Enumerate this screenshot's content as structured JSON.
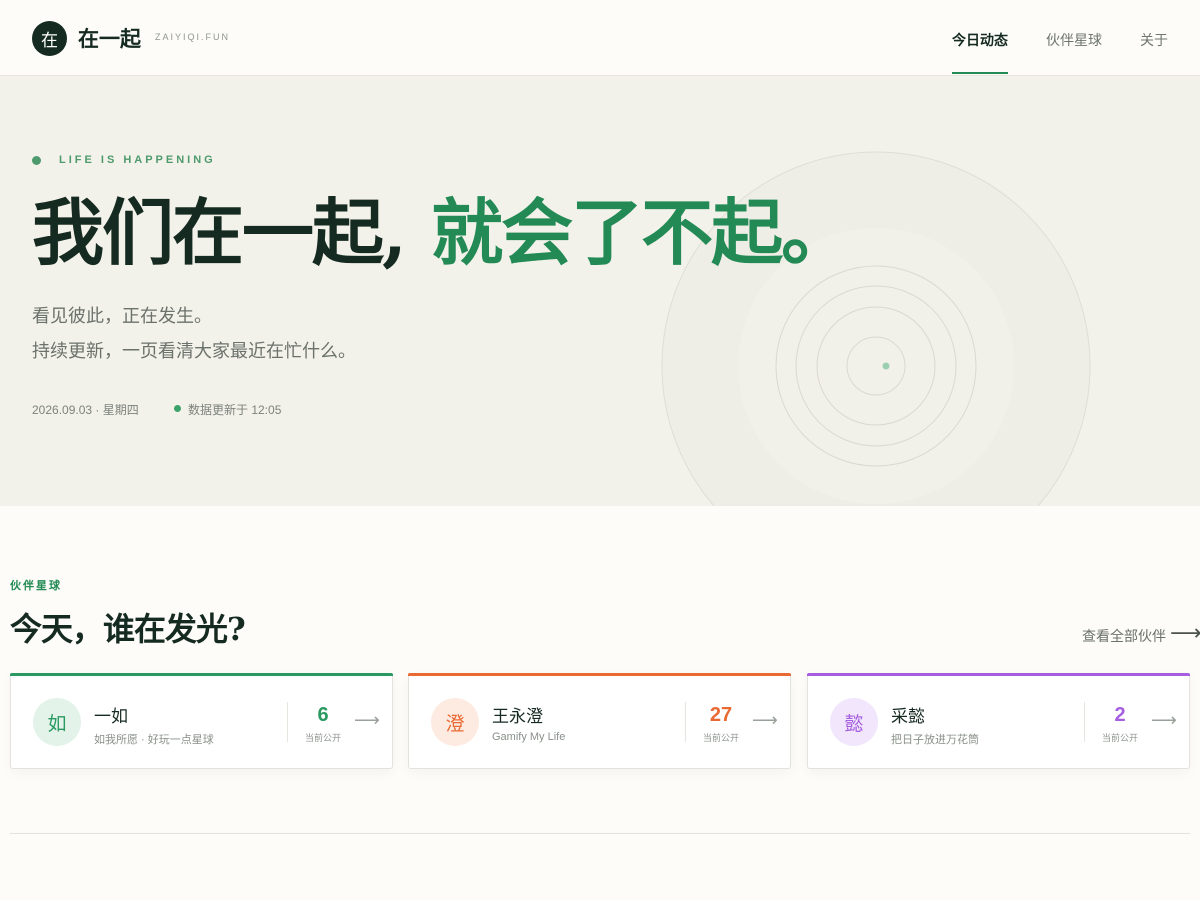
{
  "header": {
    "logo_badge": "在",
    "site_name": "在一起",
    "site_domain": "ZAIYIQI.FUN",
    "nav": [
      {
        "label": "今日动态",
        "active": true
      },
      {
        "label": "伙伴星球",
        "active": false
      },
      {
        "label": "关于",
        "active": false
      }
    ]
  },
  "hero": {
    "eyebrow": "LIFE IS HAPPENING",
    "headline_part1": "我们在一起,",
    "headline_part2": "就会了不起。",
    "subline_1": "看见彼此，正在发生。",
    "subline_2": "持续更新，一页看清大家最近在忙什么。",
    "date": "2026.09.03 · 星期四",
    "updated": "数据更新于 12:05"
  },
  "section": {
    "eyebrow": "伙伴星球",
    "title": "今天，谁在发光?",
    "view_all": "查看全部伙伴",
    "view_all_icon": "arrow-right-icon"
  },
  "cards": [
    {
      "avatar": "如",
      "name": "一如",
      "desc": "如我所愿 · 好玩一点星球",
      "count": "6",
      "count_label": "当前公开",
      "accent": "#2a9a62",
      "avatar_bg": "#e3f3ea"
    },
    {
      "avatar": "澄",
      "name": "王永澄",
      "desc": "Gamify My Life",
      "count": "27",
      "count_label": "当前公开",
      "accent": "#ea6a34",
      "avatar_bg": "#fdebe2"
    },
    {
      "avatar": "懿",
      "name": "采懿",
      "desc": "把日子放进万花筒",
      "count": "2",
      "count_label": "当前公开",
      "accent": "#a55ee0",
      "avatar_bg": "#f1e6fb"
    }
  ],
  "colors": {
    "brand_green": "#238a55",
    "hero_bg": "#f3f2ea",
    "page_bg": "#fdfcf8",
    "ink": "#152a20"
  }
}
